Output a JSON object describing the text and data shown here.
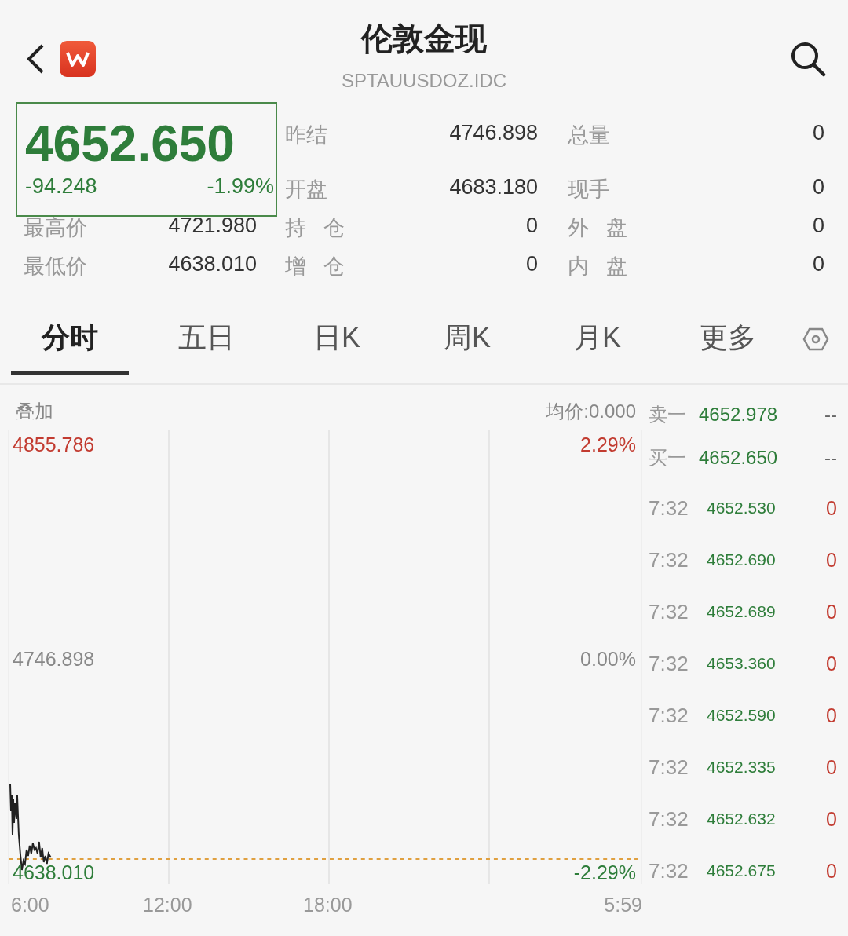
{
  "header": {
    "title": "伦敦金现",
    "code": "SPTAUUSDOZ.IDC"
  },
  "quote": {
    "price": "4652.650",
    "change": "-94.248",
    "change_pct": "-1.99%"
  },
  "stats_top": [
    {
      "label": "昨结",
      "value": "4746.898"
    },
    {
      "label": "总量",
      "value": "0"
    },
    {
      "label": "开盘",
      "value": "4683.180"
    },
    {
      "label": "现手",
      "value": "0"
    }
  ],
  "stats_bottom": [
    {
      "label": "最高价",
      "value": "4721.980"
    },
    {
      "label": "持仓",
      "value": "0"
    },
    {
      "label": "外盘",
      "value": "0"
    },
    {
      "label": "最低价",
      "value": "4638.010"
    },
    {
      "label": "增仓",
      "value": "0"
    },
    {
      "label": "内盘",
      "value": "0"
    }
  ],
  "tabs": [
    {
      "label": "分时",
      "selected": true
    },
    {
      "label": "五日",
      "selected": false
    },
    {
      "label": "日K",
      "selected": false
    },
    {
      "label": "周K",
      "selected": false
    },
    {
      "label": "月K",
      "selected": false
    },
    {
      "label": "更多",
      "selected": false
    }
  ],
  "chart": {
    "overlay_label": "叠加",
    "avg_label": "均价:0.000",
    "levels": [
      {
        "kind": "up",
        "price": "4855.786",
        "pct": "2.29%"
      },
      {
        "kind": "flat",
        "price": "4746.898",
        "pct": "0.00%"
      },
      {
        "kind": "down",
        "price": "4638.010",
        "pct": "-2.29%"
      }
    ],
    "times": [
      "6:00",
      "12:00",
      "18:00",
      "5:59"
    ]
  },
  "order_book": [
    {
      "label": "卖一",
      "price": "4652.978",
      "volume": "--"
    },
    {
      "label": "买一",
      "price": "4652.650",
      "volume": "--"
    }
  ],
  "trades": [
    {
      "time": "7:32",
      "price": "4652.530",
      "volume": "0"
    },
    {
      "time": "7:32",
      "price": "4652.690",
      "volume": "0"
    },
    {
      "time": "7:32",
      "price": "4652.689",
      "volume": "0"
    },
    {
      "time": "7:32",
      "price": "4653.360",
      "volume": "0"
    },
    {
      "time": "7:32",
      "price": "4652.590",
      "volume": "0"
    },
    {
      "time": "7:32",
      "price": "4652.335",
      "volume": "0"
    },
    {
      "time": "7:32",
      "price": "4652.632",
      "volume": "0"
    },
    {
      "time": "7:32",
      "price": "4652.675",
      "volume": "0"
    }
  ]
}
